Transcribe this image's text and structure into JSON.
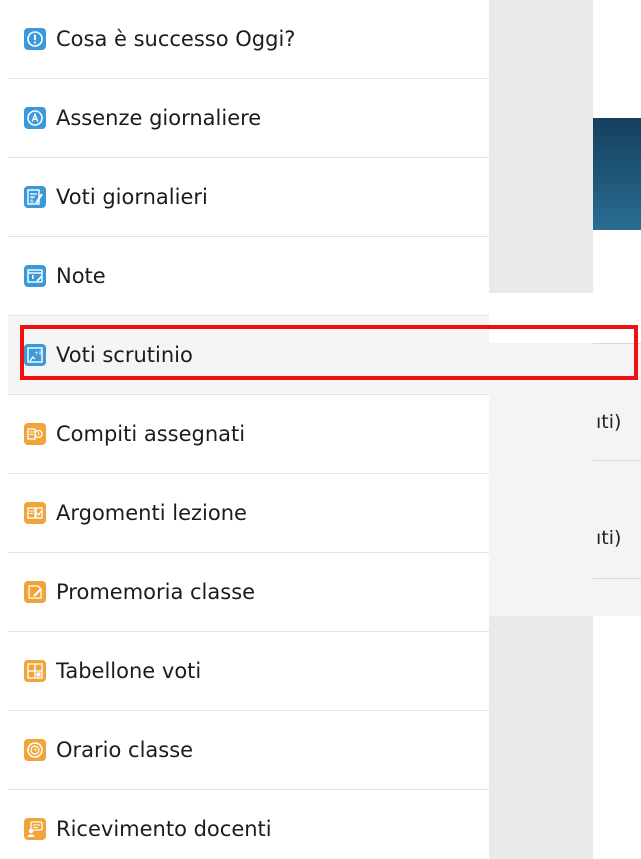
{
  "menu": {
    "items": [
      {
        "label": "Cosa è successo Oggi?",
        "icon": "exclamation-circle-icon",
        "color": "#3a99db"
      },
      {
        "label": "Assenze giornaliere",
        "icon": "letter-a-circle-icon",
        "color": "#3a99db"
      },
      {
        "label": "Voti giornalieri",
        "icon": "grade-sheet-icon",
        "color": "#3a99db"
      },
      {
        "label": "Note",
        "icon": "note-icon",
        "color": "#3a99db"
      },
      {
        "label": "Voti scrutinio",
        "icon": "final-grades-icon",
        "color": "#3a99db"
      },
      {
        "label": "Compiti assegnati",
        "icon": "homework-icon",
        "color": "#f0a43a"
      },
      {
        "label": "Argomenti lezione",
        "icon": "lesson-topics-icon",
        "color": "#f0a43a"
      },
      {
        "label": "Promemoria classe",
        "icon": "reminder-icon",
        "color": "#f0a43a"
      },
      {
        "label": "Tabellone voti",
        "icon": "grade-board-icon",
        "color": "#f0a43a"
      },
      {
        "label": "Orario classe",
        "icon": "clock-icon",
        "color": "#f0a43a"
      },
      {
        "label": "Ricevimento docenti",
        "icon": "teacher-meeting-icon",
        "color": "#f0a43a"
      }
    ],
    "highlighted": "Voti scrutinio"
  },
  "background": {
    "row1_text": "ıti)",
    "row2_text": "ıti)"
  },
  "colors": {
    "highlight_border": "#ee1111",
    "banner": "#1f5879"
  }
}
